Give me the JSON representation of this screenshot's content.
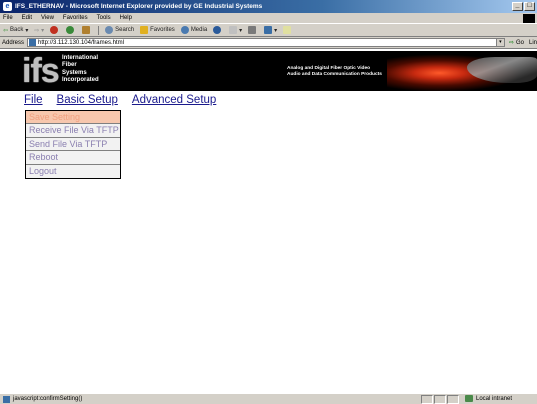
{
  "window": {
    "title": "IFS_ETHERNAV - Microsoft Internet Explorer provided by GE Industrial Systems",
    "minimize": "_",
    "maximize": "□"
  },
  "menubar": [
    "File",
    "Edit",
    "View",
    "Favorites",
    "Tools",
    "Help"
  ],
  "toolbar": {
    "back": "Back",
    "search": "Search",
    "favorites": "Favorites",
    "media": "Media"
  },
  "address": {
    "label": "Address",
    "url": "http://3.112.130.104/frames.html",
    "go": "Go",
    "links": "Lin"
  },
  "banner": {
    "logo": "ifs",
    "company_lines": [
      "International",
      "Fiber",
      "Systems",
      "Incorporated"
    ],
    "tagline_lines": [
      "Analog and Digital Fiber Optic Video",
      "Audio and Data Communication Products"
    ]
  },
  "nav": {
    "file": "File",
    "basic_setup": "Basic Setup",
    "advanced_setup": "Advanced Setup"
  },
  "file_menu": [
    {
      "label": "Save Setting",
      "active": true
    },
    {
      "label": "Receive File Via TFTP",
      "active": false
    },
    {
      "label": "Send File Via TFTP",
      "active": false
    },
    {
      "label": "Reboot",
      "active": false
    },
    {
      "label": "Logout",
      "active": false
    }
  ],
  "status": {
    "text": "javascript:confirmSetting()",
    "zone": "Local intranet"
  },
  "colors": {
    "active_item_bg": "#f7c7ad",
    "link": "#1a1a8c",
    "menu_text": "#8a7fb0"
  }
}
